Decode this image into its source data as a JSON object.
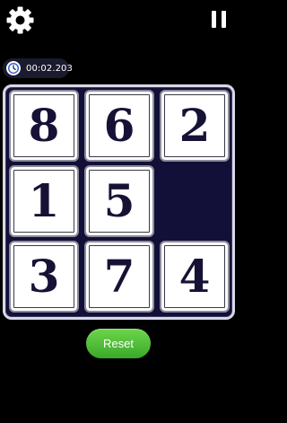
{
  "header": {
    "settings_icon": "gear-icon",
    "pause_icon": "pause-icon"
  },
  "timer": {
    "icon": "clock-icon",
    "value": "00:02.203"
  },
  "board": {
    "rows": 3,
    "cols": 3,
    "tiles": [
      {
        "row": 0,
        "col": 0,
        "label": "8"
      },
      {
        "row": 0,
        "col": 1,
        "label": "6"
      },
      {
        "row": 0,
        "col": 2,
        "label": "2"
      },
      {
        "row": 1,
        "col": 0,
        "label": "1"
      },
      {
        "row": 1,
        "col": 1,
        "label": "5"
      },
      {
        "row": 2,
        "col": 0,
        "label": "3"
      },
      {
        "row": 2,
        "col": 1,
        "label": "7"
      },
      {
        "row": 2,
        "col": 2,
        "label": "4"
      }
    ],
    "empty": {
      "row": 1,
      "col": 2
    }
  },
  "controls": {
    "reset_label": "Reset"
  },
  "colors": {
    "background": "#000000",
    "board_fill": "#120f38",
    "tile_text": "#161236",
    "reset_button": "#4fbf36"
  }
}
